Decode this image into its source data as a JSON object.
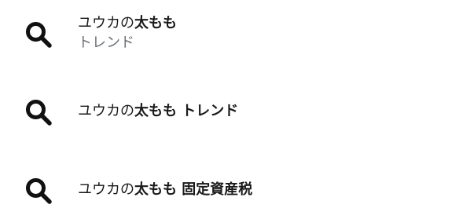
{
  "colors": {
    "text": "#1a1a1a",
    "subtext": "#6b6f76",
    "icon": "#111111"
  },
  "suggestions": [
    {
      "icon": "search-icon",
      "prefix": "ユウカの",
      "bold": "太もも",
      "sub": "トレンド"
    },
    {
      "icon": "search-icon",
      "prefix": "ユウカの",
      "bold": "太もも トレンド"
    },
    {
      "icon": "search-icon",
      "prefix": "ユウカの",
      "bold": "太もも 固定資産税"
    }
  ]
}
